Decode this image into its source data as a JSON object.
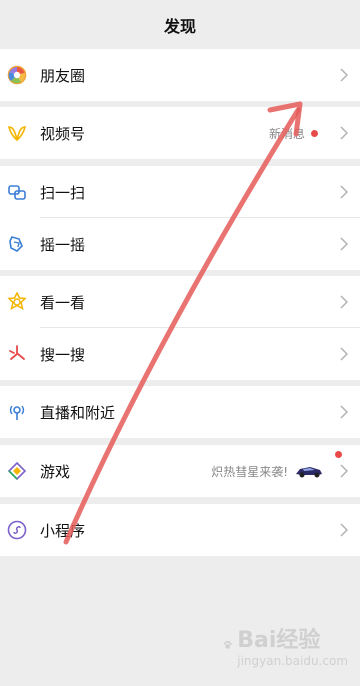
{
  "header": {
    "title": "发现"
  },
  "rows": {
    "moments": {
      "label": "朋友圈",
      "icon": "moments-icon"
    },
    "channels": {
      "label": "视频号",
      "extra": "新消息",
      "icon": "channels-icon"
    },
    "scan": {
      "label": "扫一扫",
      "icon": "scan-icon"
    },
    "shake": {
      "label": "摇一摇",
      "icon": "shake-icon"
    },
    "top_stories": {
      "label": "看一看",
      "icon": "top-stories-icon"
    },
    "search": {
      "label": "搜一搜",
      "icon": "search-icon"
    },
    "nearby": {
      "label": "直播和附近",
      "icon": "live-nearby-icon"
    },
    "games": {
      "label": "游戏",
      "extra": "炽热彗星来袭!",
      "icon": "games-icon"
    },
    "mini_programs": {
      "label": "小程序",
      "icon": "mini-programs-icon"
    }
  },
  "watermark": {
    "text": "Bai经验",
    "sub": "jingyan.baidu.com"
  },
  "colors": {
    "background": "#ededed",
    "badge_red": "#e84a4a",
    "annotation_arrow": "#e55a58"
  }
}
